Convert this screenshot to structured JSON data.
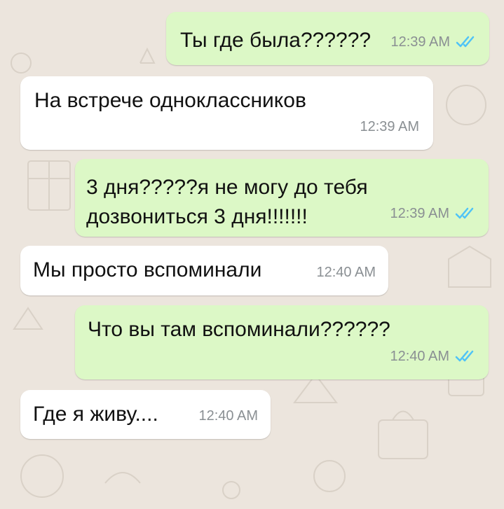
{
  "colors": {
    "background": "#ECE5DD",
    "outgoing_bubble": "#DCF8C6",
    "incoming_bubble": "#FFFFFF",
    "read_ticks": "#4FC3F7",
    "timestamp": "#8a8f93"
  },
  "messages": [
    {
      "direction": "outgoing",
      "text": "Ты где была??????",
      "time": "12:39 AM",
      "status_icon": "double-check-read-icon"
    },
    {
      "direction": "incoming",
      "text": "На встрече одноклассников",
      "time": "12:39 AM"
    },
    {
      "direction": "outgoing",
      "text": "3 дня?????я не могу до тебя\nдозвониться 3 дня!!!!!!!",
      "time": "12:39 AM",
      "status_icon": "double-check-read-icon"
    },
    {
      "direction": "incoming",
      "text": "Мы просто вспоминали",
      "time": "12:40 AM"
    },
    {
      "direction": "outgoing",
      "text": "Что вы там вспоминали??????",
      "time": "12:40 AM",
      "status_icon": "double-check-read-icon"
    },
    {
      "direction": "incoming",
      "text": "Где я живу....",
      "time": "12:40 AM"
    }
  ]
}
